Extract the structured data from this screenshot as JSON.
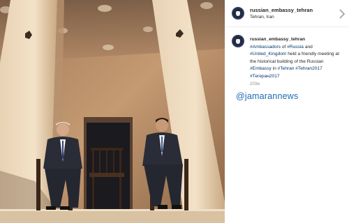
{
  "post": {
    "username": "russian_embassy_tehran",
    "location": "Tehran, Iran",
    "caption": {
      "username": "russian_embassy_tehran",
      "segments": [
        {
          "text": "#Ambassadors",
          "tag": true
        },
        {
          "text": " of ",
          "tag": false
        },
        {
          "text": "#Russia",
          "tag": true
        },
        {
          "text": " and ",
          "tag": false
        },
        {
          "text": "#United_Kingdom",
          "tag": true
        },
        {
          "text": " held a friendly meeting at the historical building of the Russian ",
          "tag": false
        },
        {
          "text": "#Embassy",
          "tag": true
        },
        {
          "text": " in ",
          "tag": false
        },
        {
          "text": "#Tehran",
          "tag": true
        },
        {
          "text": " ",
          "tag": false
        },
        {
          "text": "#Tehran2017",
          "tag": true
        },
        {
          "text": " ",
          "tag": false
        },
        {
          "text": "#Тегеран2017",
          "tag": true
        }
      ]
    },
    "time_ago": "203w"
  },
  "watermark": "@jamarannews",
  "icons": {
    "avatar": "embassy-emblem-icon",
    "scroll": "chevron-right-icon"
  },
  "colors": {
    "hashtag": "#00376b",
    "watermark": "#1b6bb4"
  }
}
